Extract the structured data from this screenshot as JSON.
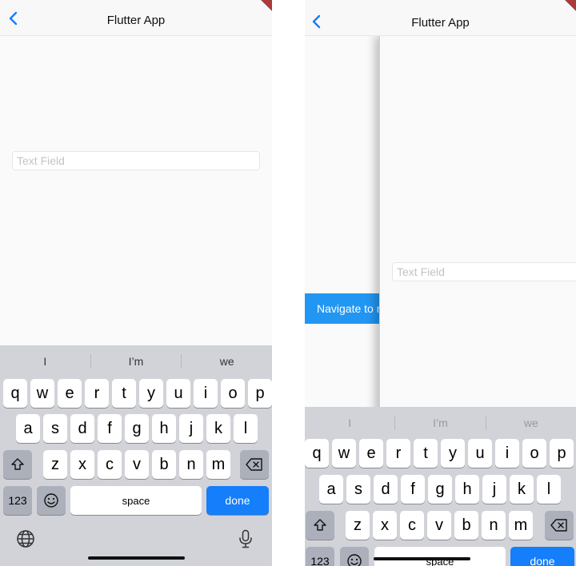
{
  "app": {
    "title": "Flutter App"
  },
  "text_field": {
    "placeholder": "Text Field",
    "value": ""
  },
  "navigate_button": {
    "label": "Navigate to n"
  },
  "keyboard": {
    "suggestions": [
      "I",
      "I’m",
      "we"
    ],
    "rows": [
      [
        "q",
        "w",
        "e",
        "r",
        "t",
        "y",
        "u",
        "i",
        "o",
        "p"
      ],
      [
        "a",
        "s",
        "d",
        "f",
        "g",
        "h",
        "j",
        "k",
        "l"
      ],
      [
        "z",
        "x",
        "c",
        "v",
        "b",
        "n",
        "m"
      ]
    ],
    "numbers_label": "123",
    "space_label": "space",
    "done_label": "done",
    "shift_icon": "shift-icon",
    "delete_icon": "delete-icon",
    "emoji_icon": "emoji-icon",
    "globe_icon": "globe-icon",
    "mic_icon": "microphone-icon",
    "accent_color": "#147efb"
  },
  "colors": {
    "nav_button": "#2196f3",
    "back_chevron": "#147efb",
    "debug_banner": "#a73b3d"
  }
}
